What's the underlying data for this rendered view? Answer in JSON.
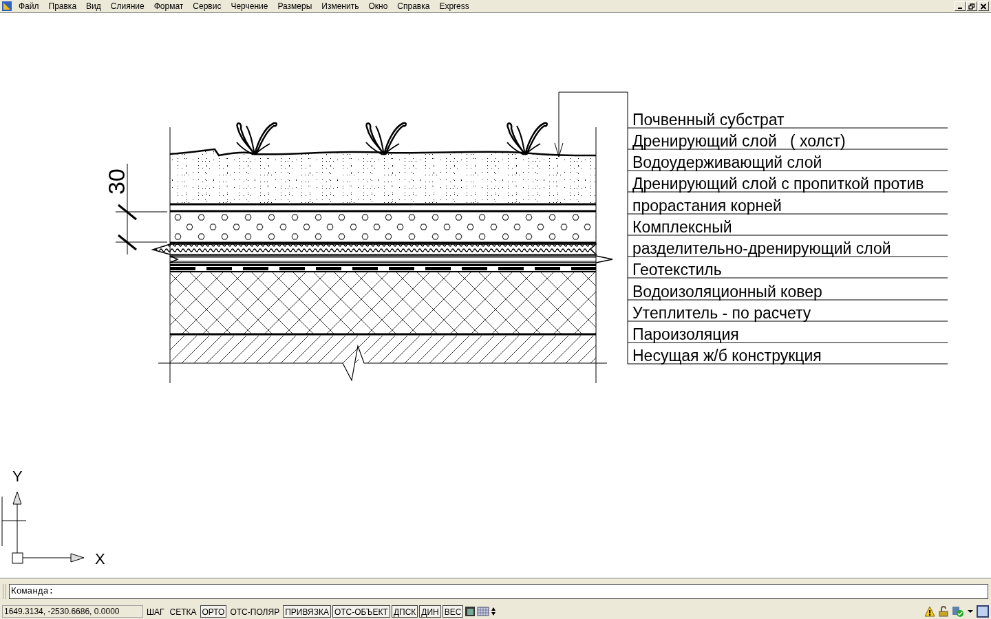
{
  "menu": [
    "Файл",
    "Правка",
    "Вид",
    "Слияние",
    "Формат",
    "Сервис",
    "Черчение",
    "Размеры",
    "Изменить",
    "Окно",
    "Справка",
    "Express"
  ],
  "drawing": {
    "dimension": "30",
    "labels": [
      "Почвенный субстрат",
      "Дренирующий слой   ( холст)",
      "Водоудерживающий слой",
      "Дренирующий слой с пропиткой против",
      "прорастания корней",
      "Комплексный",
      "разделительно-дренирующий слой",
      "Геотекстиль",
      "Водоизоляционный ковер",
      "Утеплитель - по расчету",
      "Пароизоляция",
      "Несущая ж/б конструкция"
    ],
    "ucs": {
      "x_label": "X",
      "y_label": "Y"
    }
  },
  "command": {
    "prompt": "Команда:"
  },
  "status_bar": {
    "coordinates": "1649.3134, -2530.6686, 0.0000",
    "toggles": [
      {
        "label": "ШАГ",
        "on": false
      },
      {
        "label": "СЕТКА",
        "on": false
      },
      {
        "label": "ОРТО",
        "on": true
      },
      {
        "label": "ОТС-ПОЛЯР",
        "on": false
      },
      {
        "label": "ПРИВЯЗКА",
        "on": true
      },
      {
        "label": "ОТС-ОБЪЕКТ",
        "on": true
      },
      {
        "label": "ДПСК",
        "on": true
      },
      {
        "label": "ДИН",
        "on": true
      },
      {
        "label": "ВЕС",
        "on": true
      }
    ]
  }
}
